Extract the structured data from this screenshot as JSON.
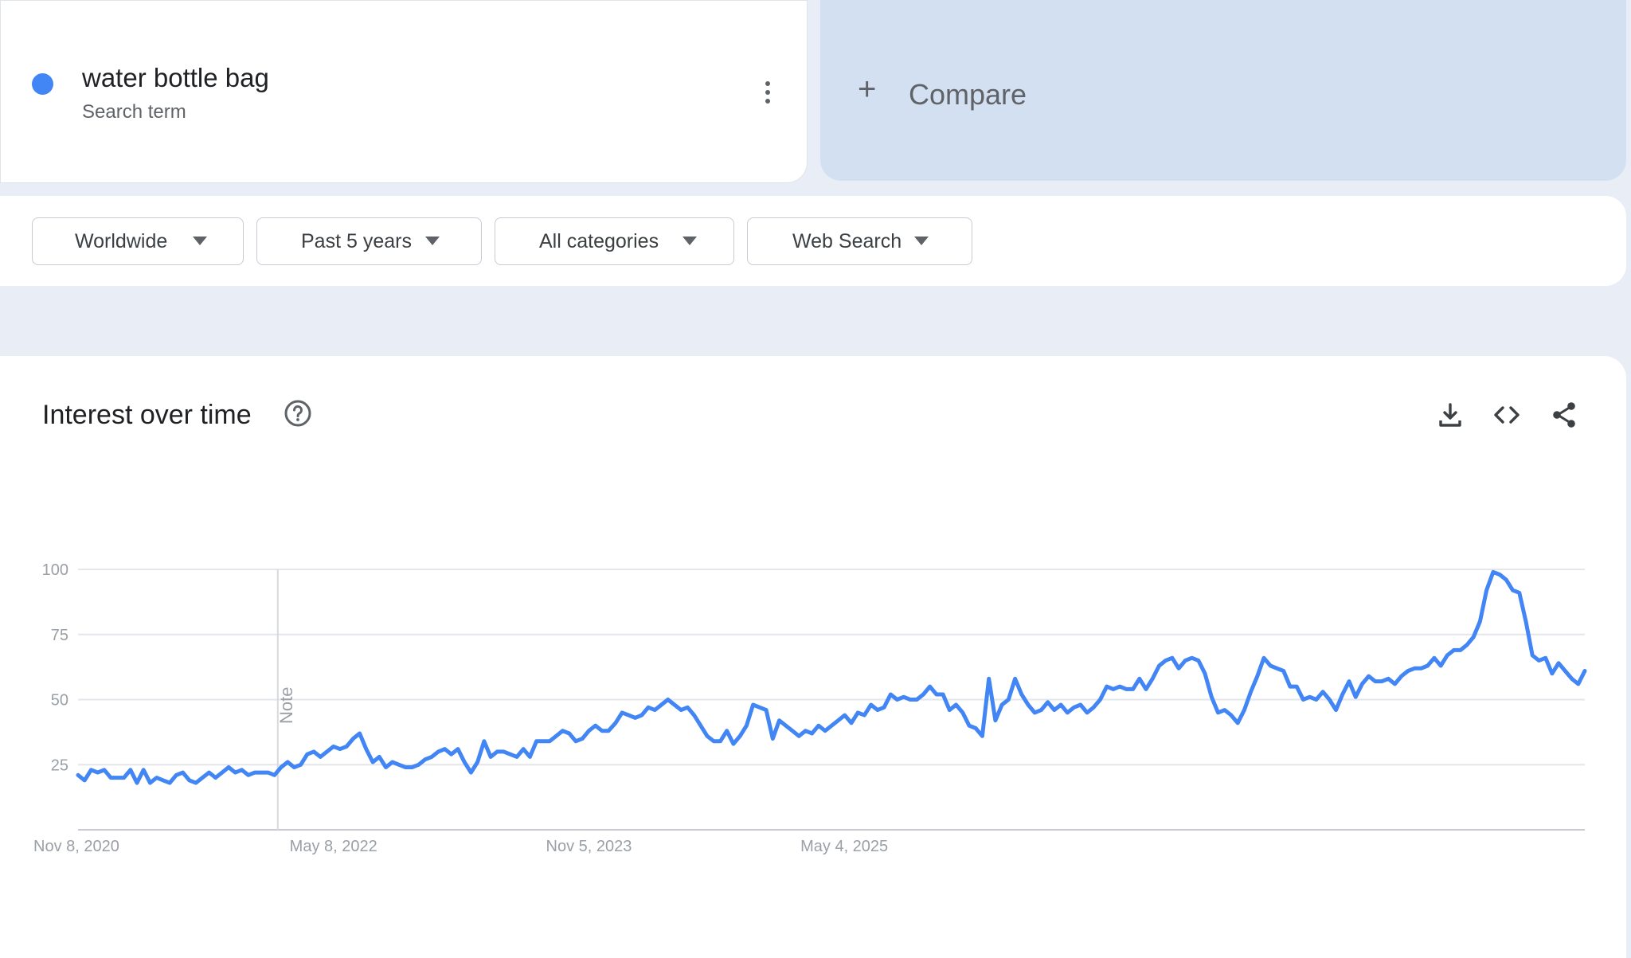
{
  "term": {
    "name": "water bottle bag",
    "subtitle": "Search term",
    "color": "#4285f4",
    "menu_icon": "more-vert-icon"
  },
  "compare": {
    "icon": "plus-icon",
    "label": "Compare"
  },
  "filters": [
    {
      "label": "Worldwide"
    },
    {
      "label": "Past 5 years"
    },
    {
      "label": "All categories"
    },
    {
      "label": "Web Search"
    }
  ],
  "panel": {
    "title": "Interest over time",
    "help_icon": "help-circle-icon",
    "tools": [
      "download-icon",
      "embed-code-icon",
      "share-icon"
    ]
  },
  "chart_data": {
    "type": "line",
    "title": "",
    "xlabel": "",
    "ylabel": "",
    "ylim": [
      0,
      100
    ],
    "y_ticks": [
      25,
      50,
      75,
      100
    ],
    "x_range": [
      "2020-11-08",
      "2025-11-02"
    ],
    "x_tick_labels": [
      {
        "date": "2020-11-08",
        "label": "Nov 8, 2020"
      },
      {
        "date": "2022-05-08",
        "label": "May 8, 2022"
      },
      {
        "date": "2023-11-05",
        "label": "Nov 5, 2023"
      },
      {
        "date": "2025-05-04",
        "label": "May 4, 2025"
      }
    ],
    "annotation": {
      "date": "2022-01-09",
      "label": "Note"
    },
    "grid": true,
    "color": "#4285f4",
    "series": [
      {
        "name": "water bottle bag",
        "points": [
          [
            "2020-11-08",
            21
          ],
          [
            "2020-11-22",
            19
          ],
          [
            "2020-12-06",
            23
          ],
          [
            "2020-12-20",
            22
          ],
          [
            "2021-01-03",
            23
          ],
          [
            "2021-01-17",
            20
          ],
          [
            "2021-01-31",
            20
          ],
          [
            "2021-02-14",
            20
          ],
          [
            "2021-02-28",
            23
          ],
          [
            "2021-03-14",
            18
          ],
          [
            "2021-03-28",
            23
          ],
          [
            "2021-04-11",
            18
          ],
          [
            "2021-04-25",
            20
          ],
          [
            "2021-05-09",
            19
          ],
          [
            "2021-05-23",
            18
          ],
          [
            "2021-06-06",
            21
          ],
          [
            "2021-06-20",
            22
          ],
          [
            "2021-07-04",
            19
          ],
          [
            "2021-07-18",
            18
          ],
          [
            "2021-08-01",
            20
          ],
          [
            "2021-08-15",
            22
          ],
          [
            "2021-08-29",
            20
          ],
          [
            "2021-09-12",
            22
          ],
          [
            "2021-09-26",
            24
          ],
          [
            "2021-10-10",
            22
          ],
          [
            "2021-10-24",
            23
          ],
          [
            "2021-11-07",
            21
          ],
          [
            "2021-11-21",
            22
          ],
          [
            "2021-12-05",
            22
          ],
          [
            "2021-12-19",
            22
          ],
          [
            "2022-01-02",
            21
          ],
          [
            "2022-01-16",
            24
          ],
          [
            "2022-01-30",
            26
          ],
          [
            "2022-02-13",
            24
          ],
          [
            "2022-02-27",
            25
          ],
          [
            "2022-03-13",
            29
          ],
          [
            "2022-03-27",
            30
          ],
          [
            "2022-04-10",
            28
          ],
          [
            "2022-04-24",
            30
          ],
          [
            "2022-05-08",
            32
          ],
          [
            "2022-05-22",
            31
          ],
          [
            "2022-06-05",
            32
          ],
          [
            "2022-06-19",
            35
          ],
          [
            "2022-07-03",
            37
          ],
          [
            "2022-07-17",
            31
          ],
          [
            "2022-07-31",
            26
          ],
          [
            "2022-08-14",
            28
          ],
          [
            "2022-08-28",
            24
          ],
          [
            "2022-09-11",
            26
          ],
          [
            "2022-09-25",
            25
          ],
          [
            "2022-10-09",
            24
          ],
          [
            "2022-10-23",
            24
          ],
          [
            "2022-11-06",
            25
          ],
          [
            "2022-11-20",
            27
          ],
          [
            "2022-12-04",
            28
          ],
          [
            "2022-12-18",
            30
          ],
          [
            "2023-01-01",
            31
          ],
          [
            "2023-01-15",
            29
          ],
          [
            "2023-01-29",
            31
          ],
          [
            "2023-02-12",
            26
          ],
          [
            "2023-02-26",
            22
          ],
          [
            "2023-03-12",
            26
          ],
          [
            "2023-03-26",
            34
          ],
          [
            "2023-04-09",
            28
          ],
          [
            "2023-04-23",
            30
          ],
          [
            "2023-05-07",
            30
          ],
          [
            "2023-05-21",
            29
          ],
          [
            "2023-06-04",
            28
          ],
          [
            "2023-06-18",
            31
          ],
          [
            "2023-07-02",
            28
          ],
          [
            "2023-07-16",
            34
          ],
          [
            "2023-07-30",
            34
          ],
          [
            "2023-08-13",
            34
          ],
          [
            "2023-08-27",
            36
          ],
          [
            "2023-09-10",
            38
          ],
          [
            "2023-09-24",
            37
          ],
          [
            "2023-10-08",
            34
          ],
          [
            "2023-10-22",
            35
          ],
          [
            "2023-11-05",
            38
          ],
          [
            "2023-11-19",
            40
          ],
          [
            "2023-12-03",
            38
          ],
          [
            "2023-12-17",
            38
          ],
          [
            "2024-01-01",
            41
          ],
          [
            "2024-01-15",
            45
          ],
          [
            "2024-01-29",
            44
          ],
          [
            "2024-02-12",
            43
          ],
          [
            "2024-02-26",
            44
          ],
          [
            "2024-03-11",
            47
          ],
          [
            "2024-03-25",
            46
          ],
          [
            "2024-04-08",
            48
          ],
          [
            "2024-04-22",
            50
          ],
          [
            "2024-05-06",
            48
          ],
          [
            "2024-05-20",
            46
          ],
          [
            "2024-06-03",
            47
          ],
          [
            "2024-06-17",
            44
          ],
          [
            "2024-07-01",
            40
          ],
          [
            "2024-07-15",
            36
          ],
          [
            "2024-07-29",
            34
          ],
          [
            "2024-08-12",
            34
          ],
          [
            "2024-08-26",
            38
          ],
          [
            "2024-09-09",
            33
          ],
          [
            "2024-09-23",
            36
          ],
          [
            "2024-10-07",
            40
          ],
          [
            "2024-10-21",
            48
          ],
          [
            "2024-11-04",
            47
          ],
          [
            "2024-11-18",
            46
          ],
          [
            "2024-12-02",
            35
          ],
          [
            "2024-12-16",
            42
          ],
          [
            "2024-12-30",
            40
          ],
          [
            "2025-01-13",
            38
          ],
          [
            "2025-01-27",
            36
          ],
          [
            "2025-02-10",
            38
          ],
          [
            "2025-02-24",
            37
          ],
          [
            "2025-03-10",
            40
          ],
          [
            "2025-03-24",
            38
          ],
          [
            "2025-04-07",
            40
          ],
          [
            "2025-04-21",
            42
          ],
          [
            "2025-05-05",
            44
          ],
          [
            "2025-05-19",
            41
          ],
          [
            "2025-06-02",
            45
          ],
          [
            "2025-06-16",
            44
          ],
          [
            "2025-06-30",
            48
          ],
          [
            "2025-07-14",
            46
          ],
          [
            "2025-07-28",
            47
          ],
          [
            "2025-08-11",
            52
          ],
          [
            "2025-08-25",
            50
          ],
          [
            "2025-09-08",
            51
          ],
          [
            "2025-09-22",
            50
          ],
          [
            "2025-10-06",
            50
          ],
          [
            "2025-10-20",
            52
          ],
          [
            "2025-11-03",
            55
          ],
          [
            "2025-11-17",
            52
          ],
          [
            "2025-12-01",
            52
          ],
          [
            "2025-12-15",
            46
          ],
          [
            "2025-12-29",
            48
          ],
          [
            "2026-01-12",
            45
          ],
          [
            "2026-01-26",
            40
          ],
          [
            "2026-02-09",
            39
          ],
          [
            "2026-02-23",
            36
          ],
          [
            "2026-03-09",
            58
          ],
          [
            "2026-03-23",
            42
          ],
          [
            "2026-04-06",
            48
          ],
          [
            "2026-04-20",
            50
          ],
          [
            "2026-05-04",
            58
          ],
          [
            "2026-05-18",
            52
          ],
          [
            "2026-06-01",
            48
          ],
          [
            "2026-06-15",
            45
          ],
          [
            "2026-06-29",
            46
          ],
          [
            "2026-07-13",
            49
          ],
          [
            "2026-07-27",
            46
          ],
          [
            "2026-08-10",
            48
          ],
          [
            "2026-08-24",
            45
          ],
          [
            "2026-09-07",
            47
          ],
          [
            "2026-09-21",
            48
          ],
          [
            "2026-10-05",
            45
          ],
          [
            "2026-10-19",
            47
          ],
          [
            "2026-11-02",
            50
          ],
          [
            "2026-11-16",
            55
          ],
          [
            "2026-11-30",
            54
          ],
          [
            "2026-12-14",
            55
          ],
          [
            "2026-12-28",
            54
          ],
          [
            "2027-01-11",
            54
          ],
          [
            "2027-01-25",
            58
          ],
          [
            "2027-02-08",
            54
          ],
          [
            "2027-02-22",
            58
          ],
          [
            "2027-03-08",
            63
          ],
          [
            "2027-03-22",
            65
          ],
          [
            "2027-04-05",
            66
          ],
          [
            "2027-04-19",
            62
          ],
          [
            "2027-05-03",
            65
          ],
          [
            "2027-05-17",
            66
          ],
          [
            "2027-05-31",
            65
          ],
          [
            "2027-06-14",
            60
          ],
          [
            "2027-06-28",
            51
          ],
          [
            "2027-07-12",
            45
          ],
          [
            "2027-07-26",
            46
          ],
          [
            "2027-08-09",
            44
          ],
          [
            "2027-08-23",
            41
          ],
          [
            "2027-09-06",
            46
          ],
          [
            "2027-09-20",
            53
          ],
          [
            "2027-10-04",
            59
          ],
          [
            "2027-10-18",
            66
          ],
          [
            "2027-11-01",
            63
          ],
          [
            "2027-11-15",
            62
          ],
          [
            "2027-11-29",
            61
          ],
          [
            "2027-12-13",
            55
          ],
          [
            "2027-12-27",
            55
          ],
          [
            "2028-01-10",
            50
          ],
          [
            "2028-01-24",
            51
          ],
          [
            "2028-02-07",
            50
          ],
          [
            "2028-02-21",
            53
          ],
          [
            "2028-03-06",
            50
          ],
          [
            "2028-03-20",
            46
          ],
          [
            "2028-04-03",
            52
          ],
          [
            "2028-04-17",
            57
          ],
          [
            "2028-05-01",
            51
          ],
          [
            "2028-05-15",
            56
          ],
          [
            "2028-05-29",
            59
          ],
          [
            "2028-06-12",
            57
          ],
          [
            "2028-06-26",
            57
          ],
          [
            "2028-07-10",
            58
          ],
          [
            "2028-07-24",
            56
          ],
          [
            "2028-08-07",
            59
          ],
          [
            "2028-08-21",
            61
          ],
          [
            "2028-09-04",
            62
          ],
          [
            "2028-09-18",
            62
          ],
          [
            "2028-10-02",
            63
          ],
          [
            "2028-10-16",
            66
          ],
          [
            "2028-10-30",
            63
          ],
          [
            "2028-11-13",
            67
          ],
          [
            "2028-11-27",
            69
          ],
          [
            "2028-12-11",
            69
          ],
          [
            "2028-12-25",
            71
          ],
          [
            "2029-01-08",
            74
          ],
          [
            "2029-01-22",
            80
          ],
          [
            "2029-02-05",
            92
          ],
          [
            "2029-02-19",
            99
          ],
          [
            "2029-03-05",
            98
          ],
          [
            "2029-03-19",
            96
          ],
          [
            "2029-04-02",
            92
          ],
          [
            "2029-04-16",
            91
          ],
          [
            "2029-04-30",
            80
          ],
          [
            "2029-05-14",
            67
          ],
          [
            "2029-05-28",
            65
          ],
          [
            "2029-06-11",
            66
          ],
          [
            "2029-06-25",
            60
          ],
          [
            "2029-07-09",
            64
          ],
          [
            "2029-07-23",
            61
          ],
          [
            "2029-08-06",
            58
          ],
          [
            "2029-08-20",
            56
          ],
          [
            "2029-09-03",
            61
          ]
        ]
      }
    ]
  }
}
